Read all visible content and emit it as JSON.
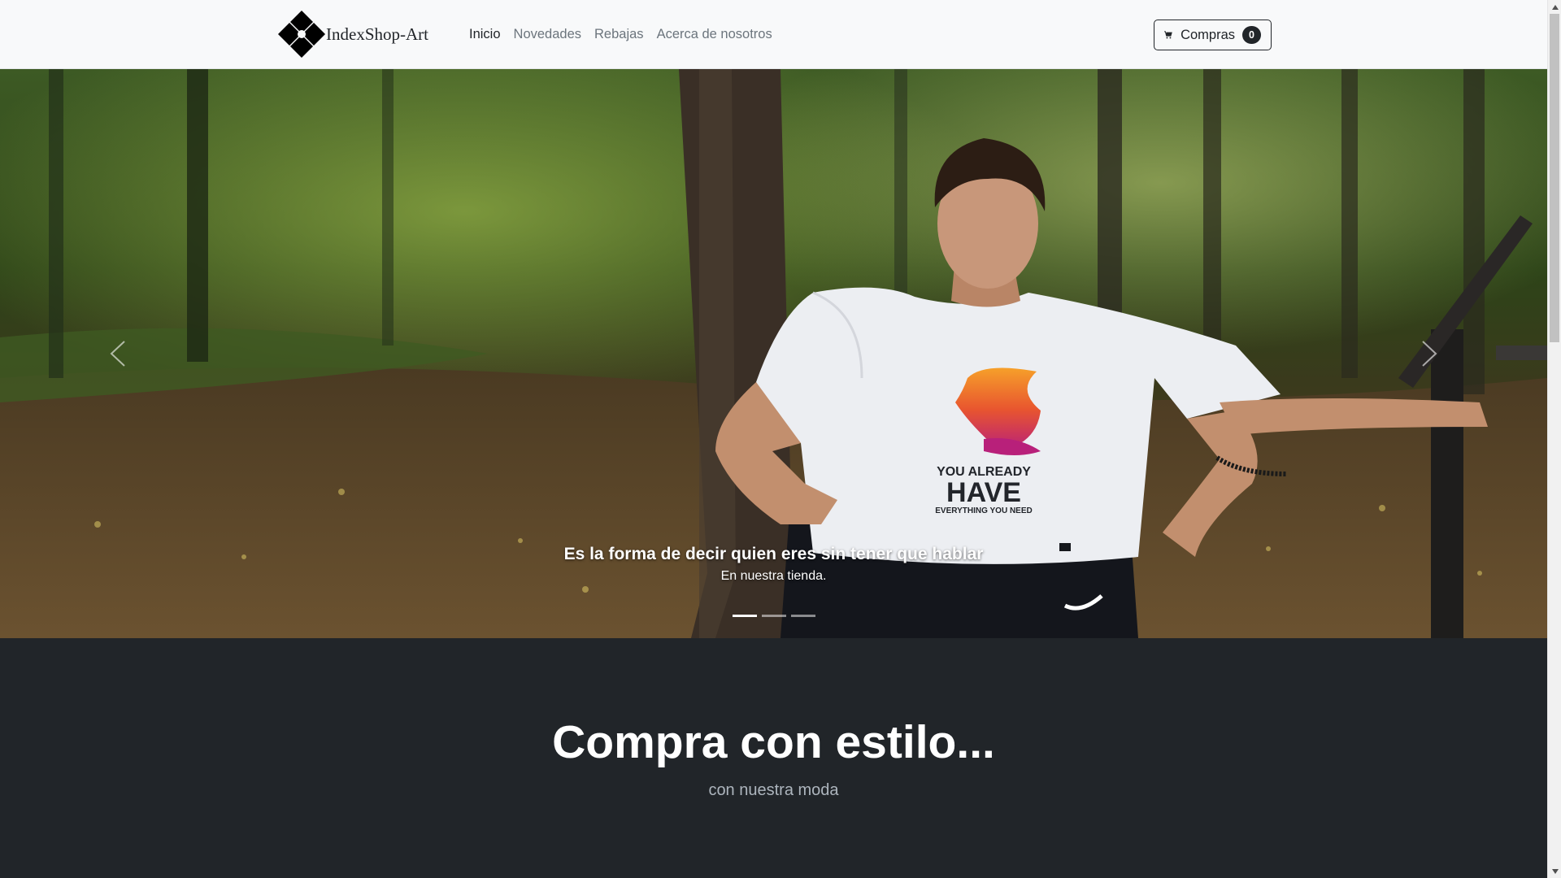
{
  "navbar": {
    "brand": "IndexShop-Art",
    "links": [
      {
        "label": "Inicio",
        "active": true
      },
      {
        "label": "Novedades",
        "active": false
      },
      {
        "label": "Rebajas",
        "active": false
      },
      {
        "label": "Acerca de nosotros",
        "active": false
      }
    ],
    "cart": {
      "label": "Compras",
      "count": "0",
      "icon": "cart-icon"
    }
  },
  "carousel": {
    "caption_title": "Es la forma de decir quien eres sin tener que hablar",
    "caption_text": "En nuestra tienda.",
    "shirt_print": {
      "line1": "YOU ALREADY",
      "line2": "HAVE",
      "line3": "EVERYTHING YOU NEED"
    },
    "slides_total": 3,
    "active_slide": 1
  },
  "promo": {
    "title": "Compra con estilo...",
    "subtitle": "con nuestra moda"
  },
  "colors": {
    "navbar_bg": "#f8f9fa",
    "dark_bg": "#212529",
    "muted": "#6c757d",
    "subtitle": "#adb5bd"
  }
}
